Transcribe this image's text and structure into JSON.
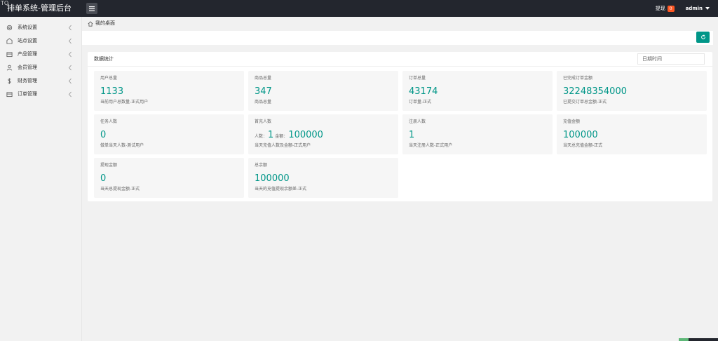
{
  "header": {
    "corner_mark": "TQ",
    "app_title": "排单系统-管理后台",
    "messages_label": "提现",
    "messages_count": "0",
    "user_name": "admin"
  },
  "sidebar": {
    "items": [
      {
        "label": "系统设置",
        "icon": "gear-icon"
      },
      {
        "label": "站点设置",
        "icon": "site-icon"
      },
      {
        "label": "产品管理",
        "icon": "product-icon"
      },
      {
        "label": "会员管理",
        "icon": "user-icon"
      },
      {
        "label": "财务管理",
        "icon": "dollar-icon"
      },
      {
        "label": "订单管理",
        "icon": "order-icon"
      }
    ]
  },
  "breadcrumb": {
    "label": "我的桌面"
  },
  "stats_panel": {
    "title": "数据统计",
    "date_placeholder": "日期时间",
    "cards": [
      {
        "label": "用户总量",
        "value": "1133",
        "desc": "当前用户总数量-正式用户"
      },
      {
        "label": "商品总量",
        "value": "347",
        "desc": "商品总量"
      },
      {
        "label": "订单总量",
        "value": "43174",
        "desc": "订单量-正式"
      },
      {
        "label": "已完成订单金额",
        "value": "32248354000",
        "desc": "已提交订单总金额-正式"
      },
      {
        "label": "任务人数",
        "value": "0",
        "desc": "做单当天人数-测试用户"
      },
      {
        "label": "首充人数",
        "count_caption": "人数：",
        "count_value": "1",
        "amount_caption": "金额：",
        "amount_value": "100000",
        "desc": "当天充值人数及金额-正式用户"
      },
      {
        "label": "注册人数",
        "value": "1",
        "desc": "当天注册人数-正式用户"
      },
      {
        "label": "充值金额",
        "value": "100000",
        "desc": "当天总充值金额-正式"
      },
      {
        "label": "提现金额",
        "value": "0",
        "desc": "当天总提现金额-正式"
      },
      {
        "label": "总余额",
        "value": "100000",
        "desc": "当天的充值提现余额差-正式"
      }
    ]
  },
  "colors": {
    "accent": "#009688",
    "topbar": "#23262e",
    "badge": "#ff5722"
  }
}
